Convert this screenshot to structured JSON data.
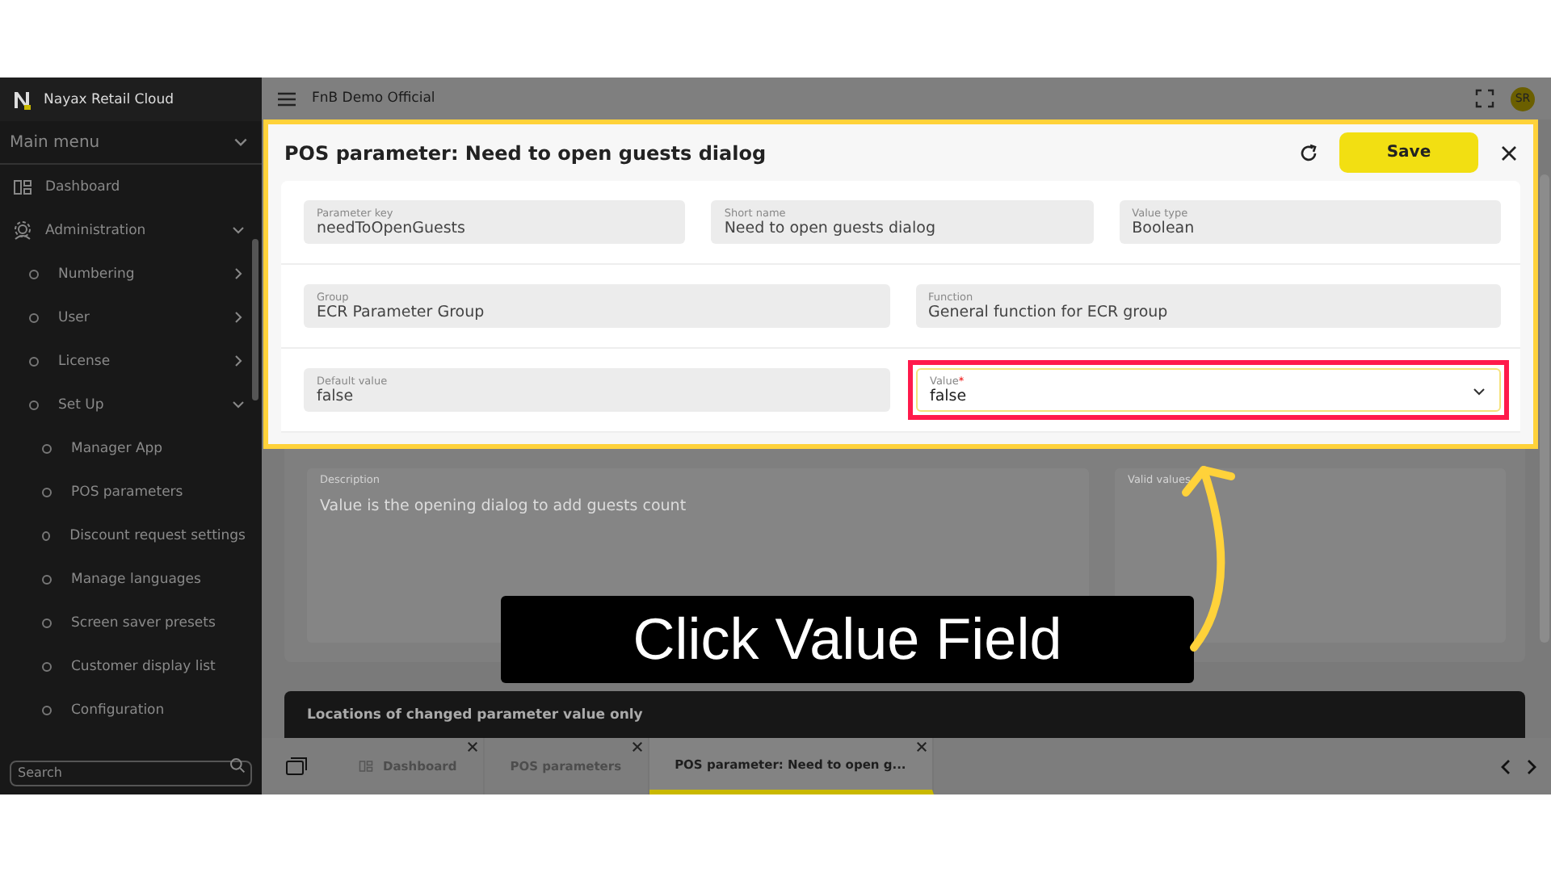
{
  "sidebar": {
    "brand": "Nayax Retail Cloud",
    "main_menu": "Main menu",
    "items": [
      {
        "label": "Dashboard",
        "kind": "dashboard"
      },
      {
        "label": "Administration",
        "kind": "admin",
        "expanded": true,
        "children": [
          {
            "label": "Numbering",
            "expanded": false
          },
          {
            "label": "User",
            "expanded": false
          },
          {
            "label": "License",
            "expanded": false
          },
          {
            "label": "Set Up",
            "expanded": true,
            "children": [
              {
                "label": "Manager App"
              },
              {
                "label": "POS parameters"
              },
              {
                "label": "Discount request settings"
              },
              {
                "label": "Manage languages"
              },
              {
                "label": "Screen saver presets"
              },
              {
                "label": "Customer display list"
              },
              {
                "label": "Configuration"
              }
            ]
          }
        ]
      }
    ],
    "search": {
      "placeholder": "Search"
    }
  },
  "topbar": {
    "title": "FnB Demo Official",
    "avatar": "SR"
  },
  "dialog": {
    "title": "POS parameter: Need to open guests dialog",
    "save": "Save",
    "rows": [
      [
        {
          "label": "Parameter key",
          "value": "needToOpenGuests"
        },
        {
          "label": "Short name",
          "value": "Need to open guests dialog"
        },
        {
          "label": "Value type",
          "value": "Boolean"
        }
      ],
      [
        {
          "label": "Group",
          "value": "ECR Parameter Group"
        },
        {
          "label": "Function",
          "value": "General function for ECR group"
        }
      ],
      [
        {
          "label": "Default value",
          "value": "false"
        },
        {
          "label": "Value",
          "required_mark": "*",
          "value": "false",
          "kind": "select",
          "highlighted": true
        }
      ]
    ],
    "description": {
      "label": "Description",
      "value": "Value is the opening dialog to add guests count"
    },
    "valid_values": {
      "label": "Valid values"
    }
  },
  "locations": {
    "title": "Locations of changed parameter value only"
  },
  "tabs": [
    {
      "label": "Dashboard",
      "kind": "dashboard",
      "selected": false
    },
    {
      "label": "POS parameters",
      "selected": false
    },
    {
      "label": "POS parameter: Need to open g...",
      "selected": true
    }
  ],
  "callout": {
    "text": "Click Value Field"
  }
}
